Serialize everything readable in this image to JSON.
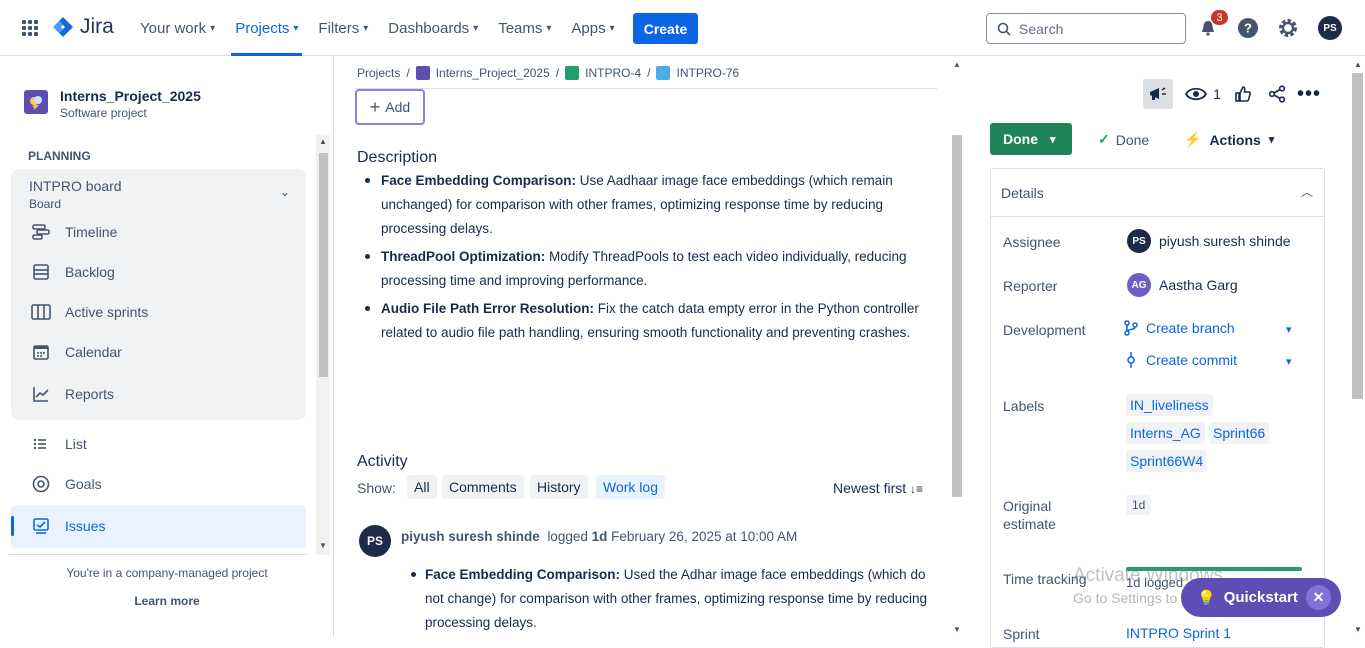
{
  "topbar": {
    "logo": "Jira",
    "nav": [
      {
        "label": "Your work"
      },
      {
        "label": "Projects"
      },
      {
        "label": "Filters"
      },
      {
        "label": "Dashboards"
      },
      {
        "label": "Teams"
      },
      {
        "label": "Apps"
      }
    ],
    "create_label": "Create",
    "search_placeholder": "Search",
    "notification_count": "3",
    "user_initials": "PS",
    "accent": "#0c66e4"
  },
  "sidebar": {
    "project_name": "Interns_Project_2025",
    "project_type": "Software project",
    "planning_header": "PLANNING",
    "board_name": "INTPRO board",
    "board_sub": "Board",
    "items": [
      {
        "label": "Timeline",
        "icon": "timeline-icon"
      },
      {
        "label": "Backlog",
        "icon": "backlog-icon"
      },
      {
        "label": "Active sprints",
        "icon": "board-icon"
      },
      {
        "label": "Calendar",
        "icon": "calendar-icon"
      },
      {
        "label": "Reports",
        "icon": "chart-icon"
      },
      {
        "label": "List",
        "icon": "list-icon"
      },
      {
        "label": "Goals",
        "icon": "goals-icon"
      },
      {
        "label": "Issues",
        "icon": "issues-icon"
      }
    ],
    "company_note": "You're in a company-managed project",
    "learn_more": "Learn more"
  },
  "main": {
    "breadcrumb": [
      "Projects",
      "Interns_Project_2025",
      "INTPRO-4",
      "INTPRO-76"
    ],
    "add_label": "Add",
    "description_heading": "Description",
    "description_items": [
      {
        "bold": "Face Embedding Comparison:",
        "text": " Use Aadhaar image face embeddings (which remain unchanged) for comparison with other frames, optimizing response time by reducing processing delays."
      },
      {
        "bold": "ThreadPool Optimization:",
        "text": " Modify ThreadPools to test each video individually, reducing processing time and improving performance."
      },
      {
        "bold": "Audio File Path Error Resolution:",
        "text": " Fix the catch data empty error in the Python controller related to audio file path handling, ensuring smooth functionality and preventing crashes."
      }
    ],
    "activity_heading": "Activity",
    "show_label": "Show:",
    "filters": [
      "All",
      "Comments",
      "History",
      "Work log"
    ],
    "sort_label": "Newest first",
    "log": {
      "initials": "PS",
      "author": "piyush suresh shinde",
      "logged_word": "logged",
      "amount": "1d",
      "date": "February 26, 2025 at 10:00 AM",
      "item_bold": "Face Embedding Comparison:",
      "item_text": " Used the Adhar image face embeddings (which do not change) for comparison with other frames, optimizing response time by reducing processing delays."
    }
  },
  "right": {
    "watch_count": "1",
    "status_button": "Done",
    "status_text": "Done",
    "actions_label": "Actions",
    "details_title": "Details",
    "assignee_label": "Assignee",
    "assignee_initials": "PS",
    "assignee": "piyush suresh shinde",
    "reporter_label": "Reporter",
    "reporter_initials": "AG",
    "reporter": "Aastha Garg",
    "development_label": "Development",
    "create_branch": "Create branch",
    "create_commit": "Create commit",
    "labels_label": "Labels",
    "labels": [
      "IN_liveliness",
      "Interns_AG",
      "Sprint66",
      "Sprint66W4"
    ],
    "estimate_label_1": "Original",
    "estimate_label_2": "estimate",
    "estimate_value": "1d",
    "time_tracking_label": "Time tracking",
    "time_logged": "1d logged",
    "sprint_label": "Sprint",
    "sprint_value": "INTPRO Sprint 1"
  },
  "overlay": {
    "watermark_title": "Activate Windows",
    "watermark_sub": "Go to Settings to activate Windows.",
    "quickstart": "Quickstart"
  }
}
